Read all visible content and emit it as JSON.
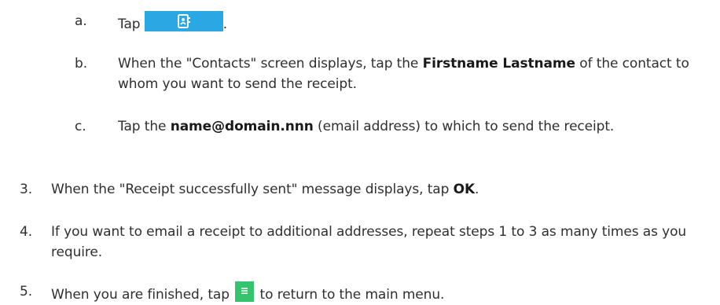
{
  "steps": [
    {
      "marker": "a.",
      "text_before": "Tap ",
      "icon": "contacts-icon",
      "text_after": "."
    },
    {
      "marker": "b.",
      "text_before": "When the \"Contacts\" screen displays, tap the ",
      "bold": "Firstname Lastname",
      "text_after": " of the contact to whom you want to send the receipt."
    },
    {
      "marker": "c.",
      "text_before": "Tap the ",
      "bold": "name@domain.nnn",
      "text_after": " (email address) to which to send the receipt."
    },
    {
      "marker": "3.",
      "text_before": "When the \"Receipt successfully sent\" message displays, tap ",
      "bold": "OK",
      "text_after": "."
    },
    {
      "marker": "4.",
      "text": "If you want to email a receipt to additional addresses, repeat steps 1 to 3 as many times as you require."
    },
    {
      "marker": "5.",
      "text_before": "When you are finished, tap ",
      "icon": "menu-icon",
      "text_after": " to return to the main menu."
    }
  ],
  "colors": {
    "contacts_button": "#2aa8e3",
    "menu_button": "#35c46e",
    "text": "#2f2f2f"
  }
}
